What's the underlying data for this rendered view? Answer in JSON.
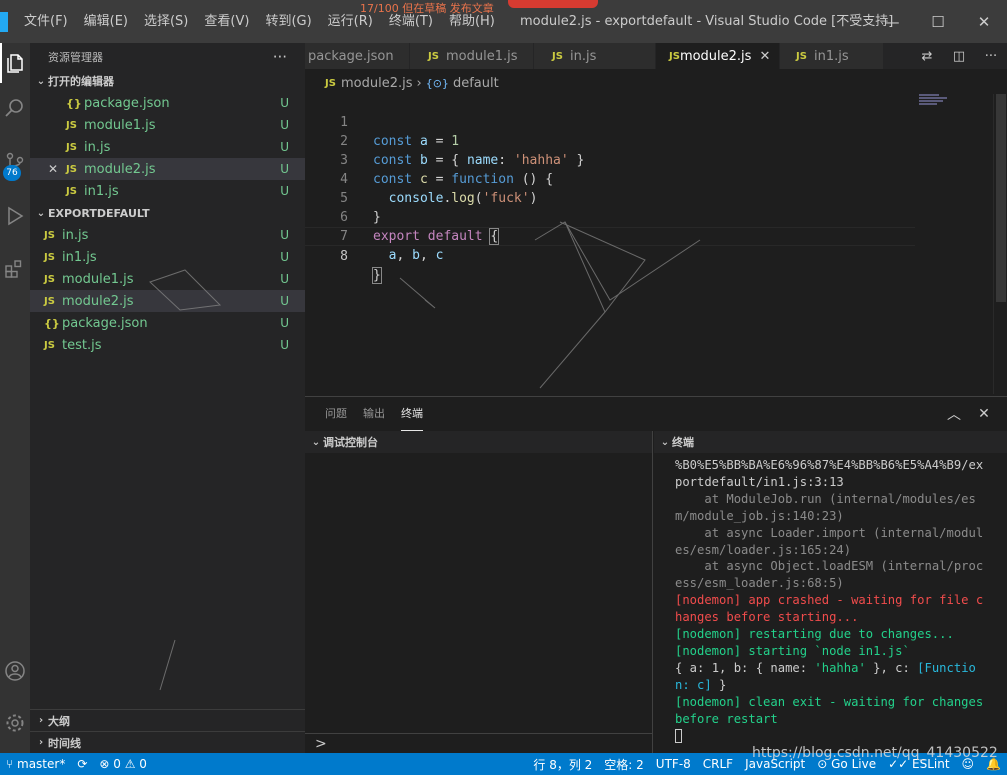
{
  "window": {
    "title": "module2.js - exportdefault - Visual Studio Code [不受支持]",
    "overlay_text": "17/100    但在草稿    发布文章",
    "controls": {
      "minimize": "—",
      "maximize": "☐",
      "close": "✕"
    }
  },
  "menu": [
    "文件(F)",
    "编辑(E)",
    "选择(S)",
    "查看(V)",
    "转到(G)",
    "运行(R)",
    "终端(T)",
    "帮助(H)"
  ],
  "activity": {
    "badge": "76"
  },
  "sidebar": {
    "header": "资源管理器",
    "more": "···",
    "open_editors_title": "打开的编辑器",
    "open_editors": [
      {
        "icon": "{}",
        "name": "package.json",
        "status": "U"
      },
      {
        "icon": "JS",
        "name": "module1.js",
        "status": "U"
      },
      {
        "icon": "JS",
        "name": "in.js",
        "status": "U"
      },
      {
        "icon": "JS",
        "name": "module2.js",
        "status": "U"
      },
      {
        "icon": "JS",
        "name": "in1.js",
        "status": "U"
      }
    ],
    "folder_title": "EXPORTDEFAULT",
    "files": [
      {
        "icon": "JS",
        "name": "in.js",
        "status": "U"
      },
      {
        "icon": "JS",
        "name": "in1.js",
        "status": "U"
      },
      {
        "icon": "JS",
        "name": "module1.js",
        "status": "U"
      },
      {
        "icon": "JS",
        "name": "module2.js",
        "status": "U"
      },
      {
        "icon": "{}",
        "name": "package.json",
        "status": "U"
      },
      {
        "icon": "JS",
        "name": "test.js",
        "status": "U"
      }
    ],
    "outline_title": "大纲",
    "timeline_title": "时间线"
  },
  "tabs": [
    {
      "icon": "",
      "name": "package.json"
    },
    {
      "icon": "JS",
      "name": "module1.js"
    },
    {
      "icon": "JS",
      "name": "in.js"
    },
    {
      "icon": "JS",
      "name": "module2.js",
      "close": "✕"
    },
    {
      "icon": "JS",
      "name": "in1.js"
    }
  ],
  "breadcrumb": {
    "file": "module2.js",
    "symbol": "default",
    "file_icon": "JS",
    "symbol_icon": "{⊙}"
  },
  "editor": {
    "line_numbers": [
      "1",
      "2",
      "3",
      "4",
      "5",
      "6",
      "7",
      "8"
    ]
  },
  "panel": {
    "tabs": [
      "问题",
      "输出",
      "终端"
    ],
    "debug_title": "调试控制台",
    "terminal_title": "终端",
    "debug_prompt": ">",
    "terminal_lines": [
      {
        "cls": "t-white",
        "text": "%B0%E5%BB%BA%E6%96%87%E4%BB%B6%E5%A4%B9/exportdefault/in1.js:3:13"
      },
      {
        "cls": "t-gray",
        "text": "    at ModuleJob.run (internal/modules/esm/module_job.js:140:23)"
      },
      {
        "cls": "t-gray",
        "text": "    at async Loader.import (internal/modules/esm/loader.js:165:24)"
      },
      {
        "cls": "t-gray",
        "text": "    at async Object.loadESM (internal/process/esm_loader.js:68:5)"
      },
      {
        "cls": "t-red",
        "text": "[nodemon] app crashed - waiting for file changes before starting..."
      },
      {
        "cls": "t-green",
        "text": "[nodemon] restarting due to changes..."
      },
      {
        "cls": "t-green",
        "text": "[nodemon] starting `node in1.js`"
      }
    ],
    "result_line": {
      "a": "{ a: ",
      "one": "1",
      "b": ", b: { name: ",
      "str": "'hahha'",
      "c": " }, c: ",
      "fn": "[Function: c]",
      "end": " }"
    },
    "final_line": "[nodemon] clean exit - waiting for changes before restart"
  },
  "status": {
    "branch": "master*",
    "sync": "⟳",
    "problems": "⊗ 0 ⚠ 0",
    "position": "行 8，列 2",
    "spaces": "空格: 2",
    "encoding": "UTF-8",
    "eol": "CRLF",
    "language": "JavaScript",
    "golive": "⊙ Go Live",
    "eslint": "✓✓ ESLint",
    "feedback": "☺",
    "bell": "🔔"
  },
  "watermark": "https://blog.csdn.net/qq_41430522",
  "colors": {
    "accent": "#007acc",
    "untracked": "#73c991",
    "js_icon": "#cbcb41"
  }
}
